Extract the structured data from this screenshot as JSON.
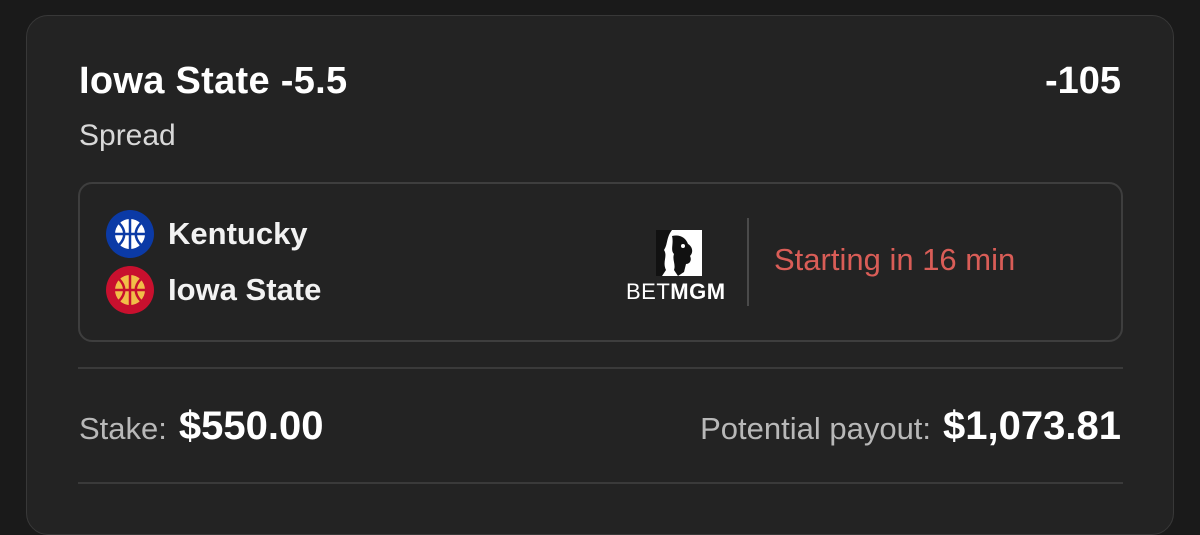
{
  "bet": {
    "title": "Iowa State -5.5",
    "odds": "-105",
    "type": "Spread"
  },
  "game": {
    "teams": [
      {
        "name": "Kentucky",
        "icon": "basketball-icon",
        "color": "#0b3aa6"
      },
      {
        "name": "Iowa State",
        "icon": "basketball-icon",
        "color": "#c8102e",
        "accent": "#f1be48"
      }
    ],
    "sportsbook": {
      "name_part1": "BET",
      "name_part2": "MGM"
    },
    "status": "Starting in 16 min",
    "status_color": "#d95d57"
  },
  "wager": {
    "stake_label": "Stake:",
    "stake_value": "$550.00",
    "payout_label": "Potential payout:",
    "payout_value": "$1,073.81"
  }
}
